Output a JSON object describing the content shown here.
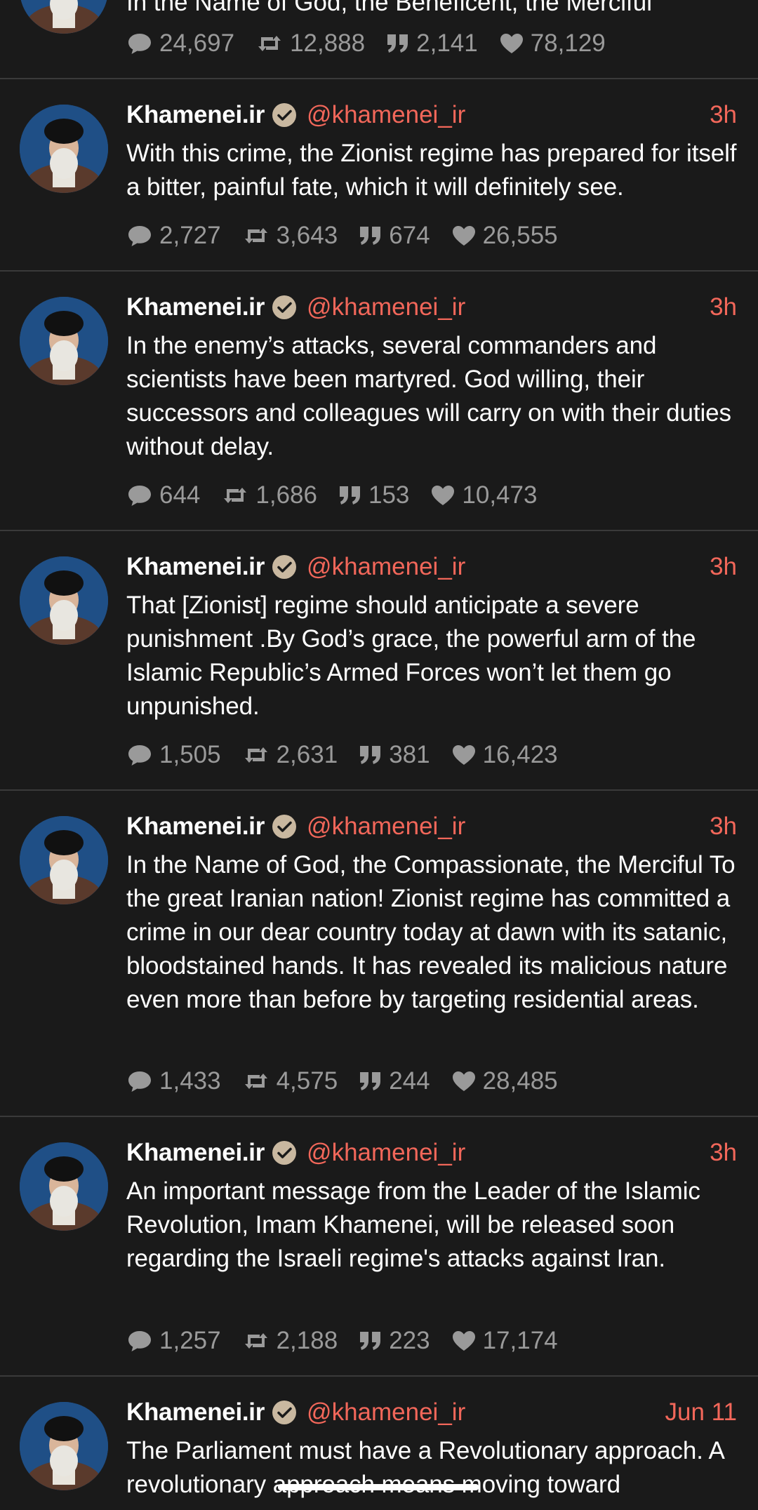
{
  "colors": {
    "background": "#1a1a1a",
    "divider": "#3a3a3a",
    "accent": "#f2675a",
    "stat_gray": "#9a9a9a",
    "text": "#ffffff"
  },
  "icons": {
    "reply": "speech-bubble-icon",
    "retweet": "retweet-icon",
    "quote": "quote-icon",
    "like": "heart-icon",
    "verified": "verified-badge-icon"
  },
  "tweets": [
    {
      "partial_text": "In the Name of God, the Beneficent, the Merciful",
      "stats": {
        "replies": "24,697",
        "retweets": "12,888",
        "quotes": "2,141",
        "likes": "78,129"
      }
    },
    {
      "name": "Khamenei.ir",
      "handle": "@khamenei_ir",
      "time": "3h",
      "text": "With this crime, the Zionist regime has prepared for itself a bitter, painful fate, which it will definitely see.",
      "stats": {
        "replies": "2,727",
        "retweets": "3,643",
        "quotes": "674",
        "likes": "26,555"
      }
    },
    {
      "name": "Khamenei.ir",
      "handle": "@khamenei_ir",
      "time": "3h",
      "text": "In the enemy’s attacks, several commanders and scientists have been martyred. God willing, their successors and colleagues will carry on with their duties without delay.",
      "stats": {
        "replies": "644",
        "retweets": "1,686",
        "quotes": "153",
        "likes": "10,473"
      }
    },
    {
      "name": "Khamenei.ir",
      "handle": "@khamenei_ir",
      "time": "3h",
      "text": "That [Zionist] regime should anticipate a severe punishment .By God’s grace, the powerful arm of the Islamic Republic’s Armed Forces won’t let them go unpunished.",
      "stats": {
        "replies": "1,505",
        "retweets": "2,631",
        "quotes": "381",
        "likes": "16,423"
      }
    },
    {
      "name": "Khamenei.ir",
      "handle": "@khamenei_ir",
      "time": "3h",
      "text": "In the Name of God, the Compassionate, the Merciful To the great Iranian nation! Zionist regime has committed a crime in our dear country today at dawn with its satanic, bloodstained hands. It has revealed its malicious nature even more than before by targeting residential areas.",
      "stats": {
        "replies": "1,433",
        "retweets": "4,575",
        "quotes": "244",
        "likes": "28,485"
      }
    },
    {
      "name": "Khamenei.ir",
      "handle": "@khamenei_ir",
      "time": "3h",
      "text": "An important message from the Leader of the Islamic Revolution, Imam Khamenei, will be released soon regarding the Israeli regime's attacks against Iran.",
      "stats": {
        "replies": "1,257",
        "retweets": "2,188",
        "quotes": "223",
        "likes": "17,174"
      }
    },
    {
      "name": "Khamenei.ir",
      "handle": "@khamenei_ir",
      "time": "Jun 11",
      "text": "The Parliament must have a Revolutionary approach. A revolutionary approach means moving toward"
    }
  ]
}
